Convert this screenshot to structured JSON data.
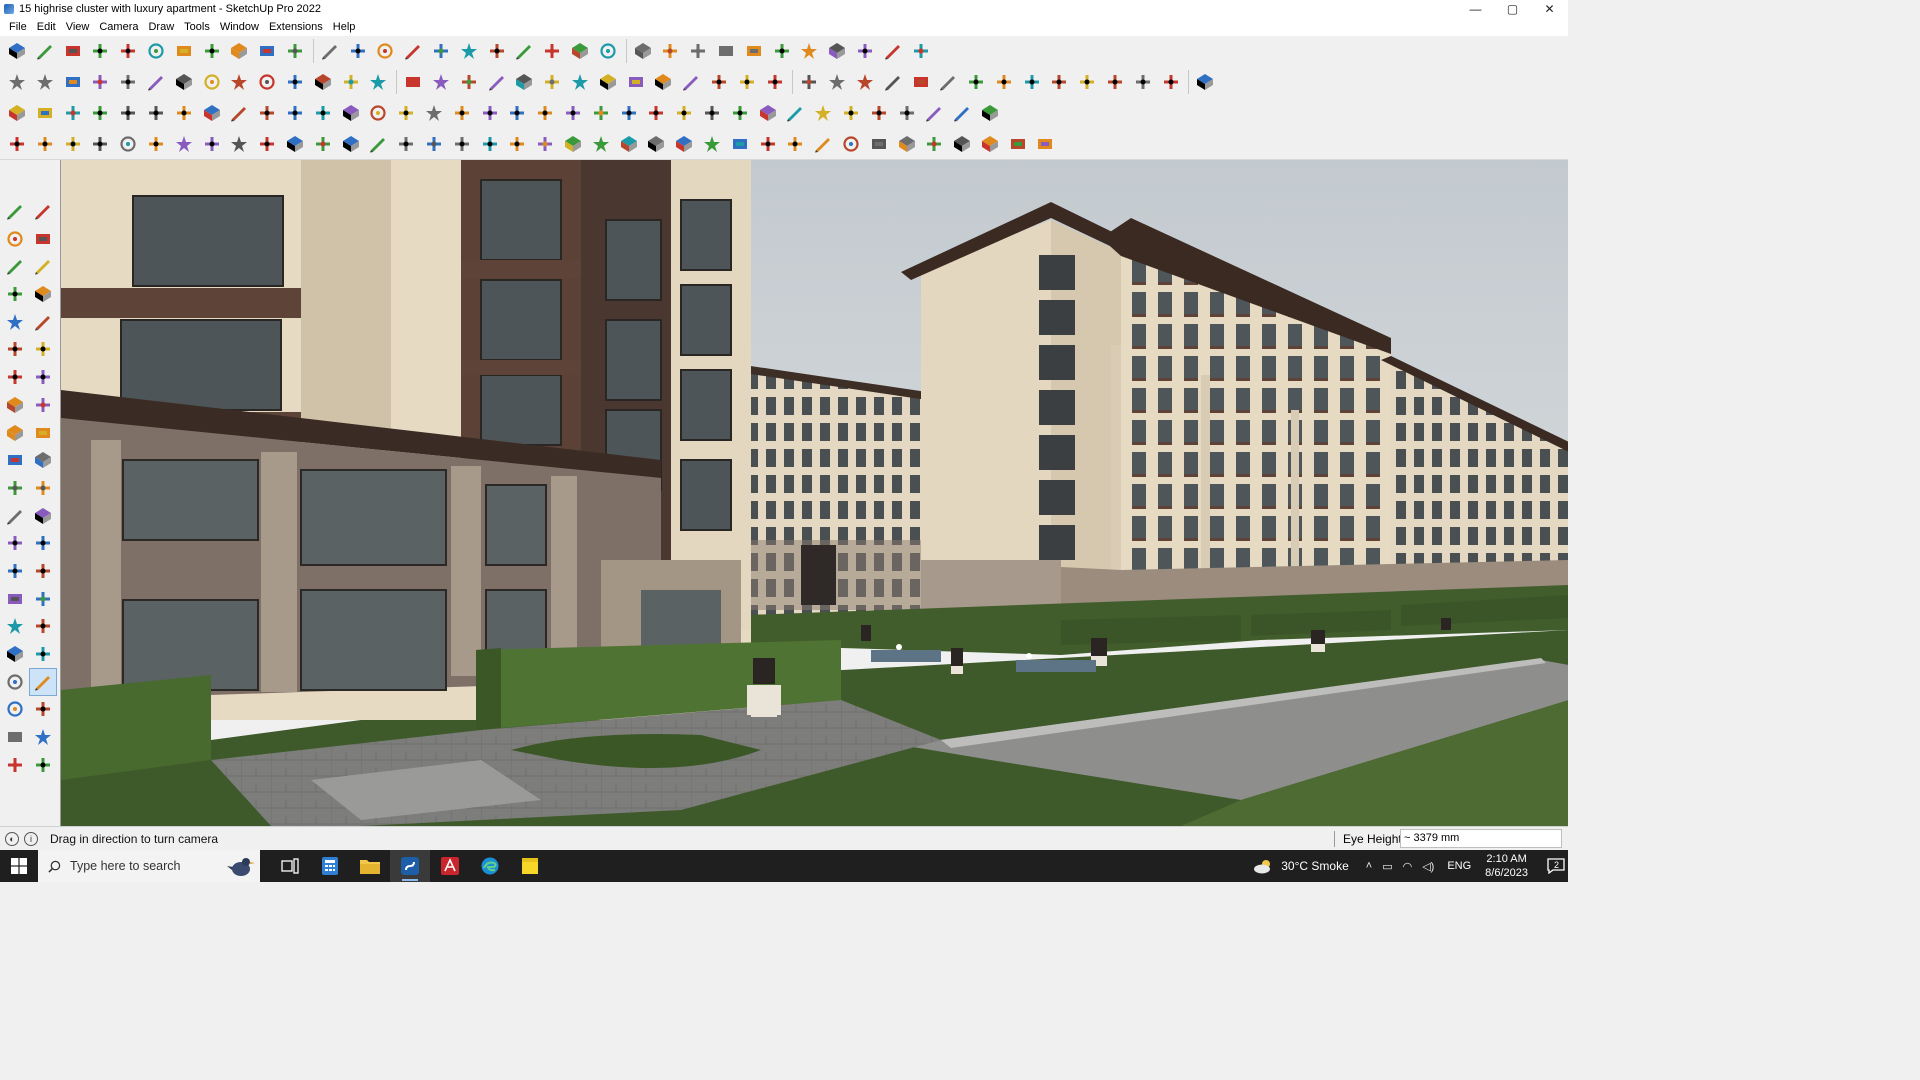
{
  "window": {
    "title": "15 highrise cluster with luxury apartment - SketchUp Pro 2022",
    "controls": {
      "minimize": "—",
      "maximize": "▢",
      "close": "✕"
    }
  },
  "menu": [
    "File",
    "Edit",
    "View",
    "Camera",
    "Draw",
    "Tools",
    "Window",
    "Extensions",
    "Help"
  ],
  "toolbars": {
    "row1": [
      "zoom-extents-icon",
      "select-icon",
      "eraser-icon",
      "line-icon",
      "arc-icon",
      "shape-icon",
      "pushpull-icon",
      "follow-me-icon",
      "move-icon",
      "rotate-icon",
      "scale-icon",
      "tape-measure-icon",
      "text-icon",
      "paint-bucket-icon",
      "orbit-icon",
      "pan-icon",
      "zoom-icon",
      "zoom-window-icon",
      "components-icon",
      "layers-icon",
      "styles-icon",
      "scenes-icon",
      "account-icon",
      "add-location-icon",
      "geo-icon",
      "sandbox-icon",
      "flip-icon",
      "flip-b-icon",
      "solid-icon",
      "section-icon",
      "undo-icon",
      "redo-icon",
      "extension-icon"
    ],
    "row2": [
      "iso-icon",
      "top-view-icon",
      "front-view-icon",
      "push-red-icon",
      "dir-red-icon",
      "dir-blue-icon",
      "dir-green-icon",
      "dir-orange-icon",
      "dir-orange2-icon",
      "dir-pink-icon",
      "curve-icon",
      "edit-icon",
      "edit2-icon",
      "edit3-icon",
      "plane-icon",
      "plane2-icon",
      "house-icon",
      "house2-icon",
      "house3-icon",
      "house4-icon",
      "house5-icon",
      "fx-icon",
      "leaf-icon",
      "pencil-red-icon",
      "rect-icon",
      "circle-icon",
      "polygon-icon",
      "ellipse-icon",
      "parallelogram-icon",
      "curve2-icon",
      "circle2-icon",
      "bezier-icon",
      "curve3-icon",
      "circle3-icon",
      "red-line-icon",
      "pink-eraser-icon",
      "solid2-icon",
      "solid3-icon",
      "render-icon",
      "render2-icon",
      "render3-icon",
      "render4-icon",
      "render5-icon"
    ],
    "row3": [
      "box-blue-icon",
      "box-blue2-icon",
      "plane-yellow-icon",
      "plane-green-icon",
      "box-red-icon",
      "box-white-icon",
      "undo-orange-icon",
      "square-red-icon",
      "panel-icon",
      "flag-icon",
      "wood-icon",
      "hook-icon",
      "dots-icon",
      "cross-red-icon",
      "cross-green-icon",
      "cross-blue-icon",
      "cone-icon",
      "warn-icon",
      "spiral-icon",
      "spiral2-icon",
      "spiral3-icon",
      "star-icon",
      "cube-icon",
      "magnet-icon",
      "tree-icon",
      "move-red-icon",
      "split-icon",
      "split2-icon",
      "gem-icon",
      "grid-icon",
      "sun-icon",
      "grid2-icon",
      "grid3-icon",
      "scatter-icon",
      "curve4-icon",
      "cluster-icon"
    ],
    "row4": [
      "line2-icon",
      "path-icon",
      "car-icon",
      "clamp-icon",
      "gear-icon",
      "shape2-icon",
      "sweep-icon",
      "box3-icon",
      "sphere-icon",
      "funnel-icon",
      "line3-icon",
      "line4-icon",
      "pen-red-icon",
      "arc2-icon",
      "frame-icon",
      "slope-icon",
      "comb-icon",
      "comb2-icon",
      "pulley-icon",
      "shell-icon",
      "star2-icon",
      "stack-icon",
      "slash-icon",
      "scissors-icon",
      "scissors2-icon",
      "scissors3-icon",
      "print-icon",
      "stripes-icon",
      "gate-icon",
      "hook2-icon",
      "stack2-icon",
      "checker-icon",
      "stack3-icon",
      "barcode-icon",
      "spiral4-icon",
      "wave-icon",
      "bars-icon",
      "cube2-icon"
    ]
  },
  "palette": [
    "select-icon",
    "orbit-icon",
    "paint-bucket-icon",
    "eraser-icon",
    "components-icon",
    "tape-icon",
    "line-icon",
    "freehand-icon",
    "rectangle-icon",
    "rotated-rect-icon",
    "circle-icon",
    "polygon-icon",
    "arc-icon",
    "pie-icon",
    "arc3-icon",
    "arc4-icon",
    "move-icon",
    "pushpull-icon",
    "rotate-icon",
    "followme-icon",
    "scale-icon",
    "offset-icon",
    "tape-measure-icon",
    "dimension-icon",
    "protractor-icon",
    "text-icon",
    "axes-icon",
    "3dtext-icon",
    "orbit2-icon",
    "pan-icon",
    "zoom-icon",
    "zoom-window-icon",
    "zoom-extents-icon",
    "previous-icon",
    "position-camera-icon",
    "look-around-icon",
    "walk-icon",
    "section-plane-icon",
    "sandbox-icon",
    "sandbox2-icon",
    "layers-icon",
    "layers2-icon"
  ],
  "statusbar": {
    "hint": "Drag in direction to turn camera",
    "vcb_label": "Eye Height",
    "vcb_value": "~ 3379 mm"
  },
  "taskbar": {
    "search_placeholder": "Type here to search",
    "weather": "30°C  Smoke",
    "language": "ENG",
    "time": "2:10 AM",
    "date": "8/6/2023",
    "notifications": "2"
  },
  "colors": {
    "sky": "#c9cfd4",
    "facade_cream": "#e8dcc6",
    "facade_brown": "#5e4438",
    "window_glass": "#5c6466",
    "lawn": "#3f5a2a",
    "pavement": "#8c8c8a",
    "selected_tool": "#cde3f7"
  }
}
